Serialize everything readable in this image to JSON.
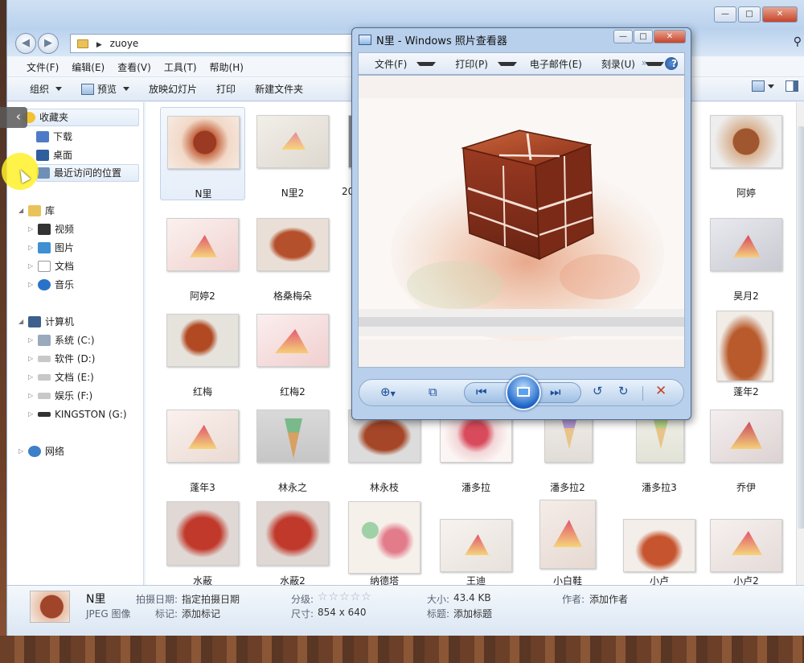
{
  "explorer": {
    "address": {
      "folder": "zuoye"
    },
    "menu": [
      "文件(F)",
      "编辑(E)",
      "查看(V)",
      "工具(T)",
      "帮助(H)"
    ],
    "toolbar": {
      "organize": "组织",
      "preview": "预览",
      "slideshow": "放映幻灯片",
      "print": "打印",
      "new_folder": "新建文件夹"
    },
    "nav": {
      "favorites": "收藏夹",
      "downloads": "下载",
      "desktop": "桌面",
      "recent": "最近访问的位置",
      "libraries": "库",
      "videos": "视频",
      "pictures": "图片",
      "documents": "文档",
      "music": "音乐",
      "computer": "计算机",
      "drive_c": "系统 (C:)",
      "drive_d": "软件 (D:)",
      "drive_e": "文档 (E:)",
      "drive_f": "娱乐 (F:)",
      "drive_g": "KINGSTON (G:)",
      "network": "网络"
    },
    "files": [
      "N里",
      "N里2",
      "20",
      "阿婷",
      "阿婷2",
      "格桑梅朵",
      "昊月2",
      "红梅",
      "红梅2",
      "蓬年2",
      "蓬年3",
      "林永之",
      "林永枝",
      "潘多拉",
      "潘多拉2",
      "潘多拉3",
      "乔伊",
      "水蔽",
      "水蔽2",
      "纳德塔",
      "王迪",
      "小白鞋",
      "小卢",
      "小卢2"
    ],
    "details": {
      "name": "N里",
      "type": "JPEG 图像",
      "date_label": "拍摄日期:",
      "date_value": "指定拍摄日期",
      "tags_label": "标记:",
      "tags_value": "添加标记",
      "rating_label": "分级:",
      "rating_stars": "☆☆☆☆☆",
      "dims_label": "尺寸:",
      "dims_value": "854 x 640",
      "size_label": "大小:",
      "size_value": "43.4 KB",
      "title_label": "标题:",
      "title_value": "添加标题",
      "author_label": "作者:",
      "author_value": "添加作者"
    }
  },
  "viewer": {
    "title": "N里 - Windows 照片查看器",
    "menu": {
      "file": "文件(F)",
      "print": "打印(P)",
      "email": "电子邮件(E)",
      "burn": "刻录(U)",
      "help": "?"
    }
  },
  "colors": {
    "accent": "#1e66c8",
    "window_frame": "#b8d0ec",
    "close_red": "#c6442a"
  }
}
